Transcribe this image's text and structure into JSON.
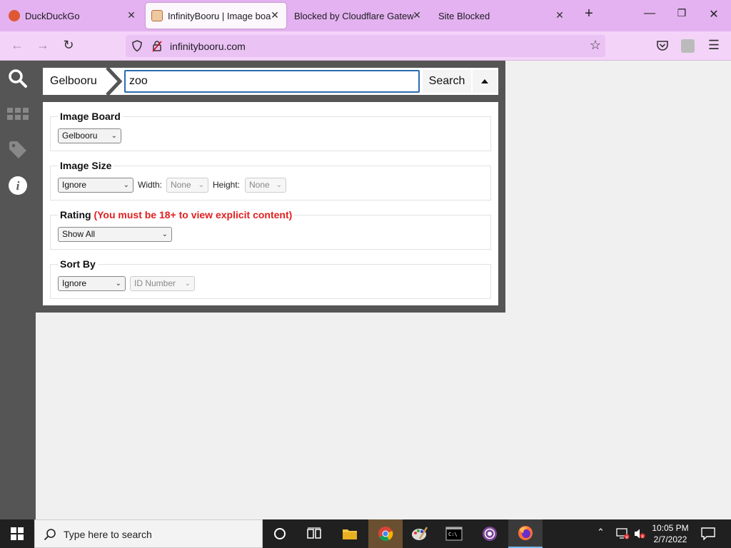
{
  "tabs": [
    {
      "title": "DuckDuckGo",
      "favicon": "duckduckgo-icon"
    },
    {
      "title": "InfinityBooru | Image board",
      "favicon": "infinitybooru-icon",
      "active": true
    },
    {
      "title": "Blocked by Cloudflare Gateway",
      "favicon": ""
    },
    {
      "title": "Site Blocked",
      "favicon": ""
    }
  ],
  "nav": {
    "url": "infinitybooru.com"
  },
  "search": {
    "breadcrumb": "Gelbooru",
    "query": "zoo",
    "button_label": "Search"
  },
  "filters": {
    "image_board": {
      "legend": "Image Board",
      "value": "Gelbooru"
    },
    "image_size": {
      "legend": "Image Size",
      "value": "Ignore",
      "width_label": "Width:",
      "width_value": "None",
      "height_label": "Height:",
      "height_value": "None"
    },
    "rating": {
      "legend": "Rating",
      "warning": "(You must be 18+ to view explicit content)",
      "value": "Show All"
    },
    "sort_by": {
      "legend": "Sort By",
      "value": "Ignore",
      "secondary_value": "ID Number"
    }
  },
  "taskbar": {
    "search_placeholder": "Type here to search",
    "time": "10:05 PM",
    "date": "2/7/2022"
  },
  "colors": {
    "tab_bar": "#e4b2f0",
    "nav_bar": "#f4d3f9",
    "panel": "#555555",
    "warning": "#e02020",
    "focus": "#2a6db0"
  }
}
